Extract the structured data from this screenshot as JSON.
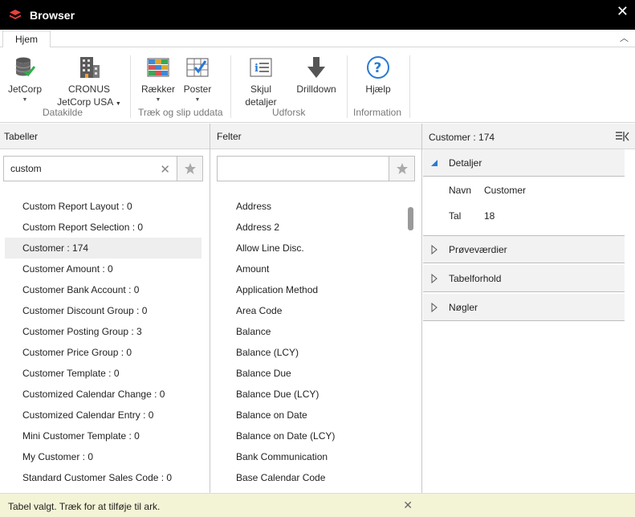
{
  "window": {
    "title": "Browser"
  },
  "tabs": {
    "home": "Hjem"
  },
  "ribbon": {
    "jetcorp": "JetCorp",
    "cronus_line1": "CRONUS",
    "cronus_line2": "JetCorp USA",
    "datasource_group": "Datakilde",
    "rows": "Rækker",
    "entries": "Poster",
    "drag_group": "Træk og slip uddata",
    "hide_line1": "Skjul",
    "hide_line2": "detaljer",
    "drilldown": "Drilldown",
    "output_group": "Udforsk",
    "help": "Hjælp",
    "info_group": "Information"
  },
  "tables": {
    "header": "Tabeller",
    "search_value": "custom",
    "items": [
      "Custom Report Layout : 0",
      "Custom Report Selection : 0",
      "Customer : 174",
      "Customer Amount : 0",
      "Customer Bank Account : 0",
      "Customer Discount Group : 0",
      "Customer Posting Group : 3",
      "Customer Price Group : 0",
      "Customer Template : 0",
      "Customized Calendar Change : 0",
      "Customized Calendar Entry : 0",
      "Mini Customer Template : 0",
      "My Customer : 0",
      "Standard Customer Sales Code : 0"
    ]
  },
  "fields": {
    "header": "Felter",
    "search_value": "",
    "items": [
      "Address",
      "Address 2",
      "Allow Line Disc.",
      "Amount",
      "Application Method",
      "Area Code",
      "Balance",
      "Balance (LCY)",
      "Balance Due",
      "Balance Due (LCY)",
      "Balance on Date",
      "Balance on Date (LCY)",
      "Bank Communication",
      "Base Calendar Code"
    ]
  },
  "details": {
    "header": "Customer : 174",
    "details_section": "Detaljer",
    "name_key": "Navn",
    "name_value": "Customer",
    "count_key": "Tal",
    "count_value": "18",
    "sample_section": "Prøveværdier",
    "relations_section": "Tabelforhold",
    "keys_section": "Nøgler"
  },
  "status": {
    "message": "Tabel valgt. Træk for at tilføje til ark."
  }
}
